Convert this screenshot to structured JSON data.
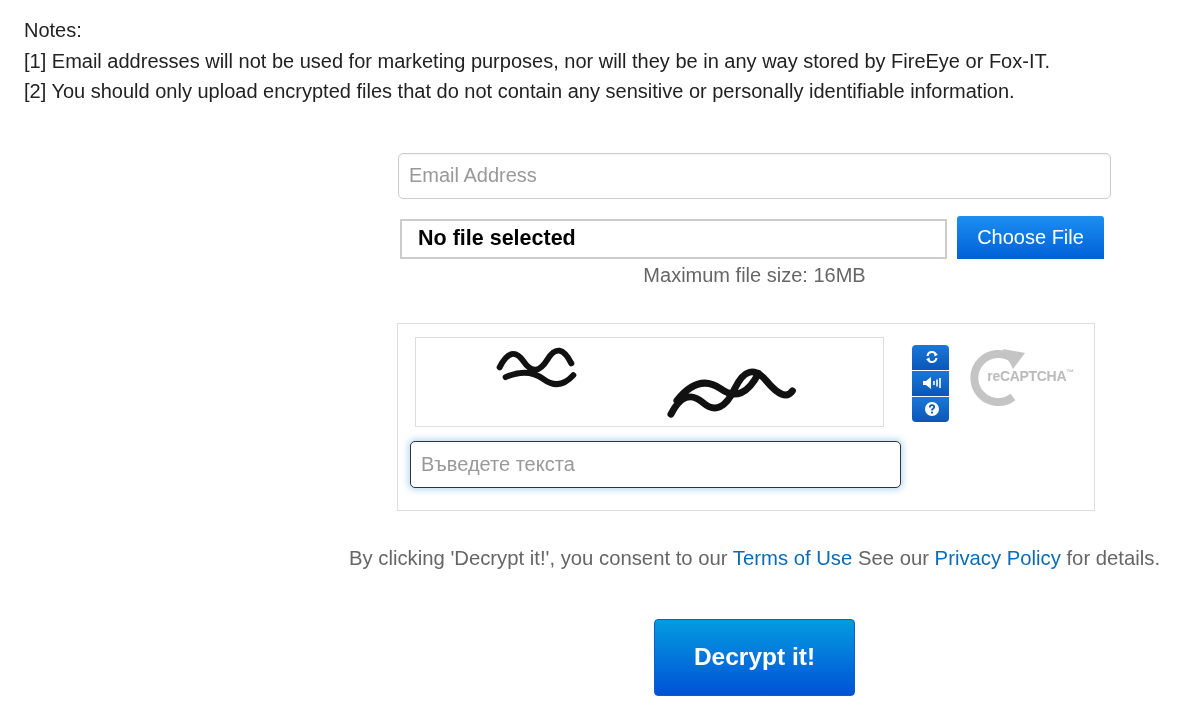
{
  "notes": {
    "heading": "Notes:",
    "items": [
      "[1] Email addresses will not be used for marketing purposes, nor will they be in any way stored by FireEye or Fox-IT.",
      "[2] You should only upload encrypted files that do not contain any sensitive or personally identifiable information."
    ]
  },
  "email": {
    "placeholder": "Email Address"
  },
  "file": {
    "status": "No file selected",
    "button": "Choose File",
    "hint": "Maximum file size: 16MB"
  },
  "captcha": {
    "controls": [
      {
        "kind": "refresh"
      },
      {
        "kind": "audio"
      },
      {
        "kind": "help"
      }
    ],
    "logo_text": "reCAPTCHA$^{™}$",
    "answer": {
      "placeholder": "Въведете текста",
      "focused": true
    }
  },
  "consent": {
    "parts": [
      {
        "kind": "text",
        "text": "By clicking 'Decrypt it!', you consent to our "
      },
      {
        "kind": "link",
        "text": "Terms of Use"
      },
      {
        "kind": "text",
        "text": " See our "
      },
      {
        "kind": "link",
        "text": "Privacy Policy"
      },
      {
        "kind": "text",
        "text": " for details."
      }
    ]
  },
  "submit": {
    "label": "Decrypt it!"
  }
}
